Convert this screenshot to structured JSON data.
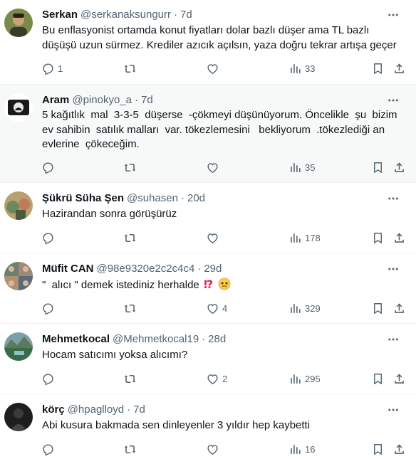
{
  "tweets": [
    {
      "name": "Serkan",
      "handle": "@serkanaksungurr",
      "time": "7d",
      "text": "Bu enflasyonist ortamda konut fiyatları dolar bazlı düşer ama TL bazlı düşüşü uzun sürmez. Krediler azıcık açılsın, yaza doğru tekrar artışa geçer",
      "replies": "1",
      "retweets": "",
      "likes": "",
      "views": "33",
      "avatar_color": "#6b7f3a"
    },
    {
      "name": "Aram",
      "handle": "@pinokyo_a",
      "time": "7d",
      "text": "5 kağıtlık  mal  3-3-5  düşerse  -çökmeyi düşünüyorum. Öncelikle  şu  bizim ev sahibin  satılık malları  var. tökezlemesini   bekliyorum  .tökezlediği an evlerine  çökeceğim.",
      "replies": "",
      "retweets": "",
      "likes": "",
      "views": "35",
      "avatar_color": "#1a1a1a"
    },
    {
      "name": "Şükrü Süha Şen",
      "handle": "@suhasen",
      "time": "20d",
      "text": "Hazirandan sonra görüşürüz",
      "replies": "",
      "retweets": "",
      "likes": "",
      "views": "178",
      "avatar_color": "#a08a4a"
    },
    {
      "name": "Müfit CAN",
      "handle": "@98e9320e2c2c4c4",
      "time": "29d",
      "text": "\"  alıcı \" demek istediniz herhalde ⁉️🥹",
      "text_plain": "\"  alıcı \" demek istediniz herhalde ",
      "replies": "",
      "retweets": "",
      "likes": "4",
      "views": "329",
      "avatar_color": "#8a6f5a"
    },
    {
      "name": "Mehmetkocal",
      "handle": "@Mehmetkocal19",
      "time": "28d",
      "text": "Hocam satıcımı yoksa alıcımı?",
      "replies": "",
      "retweets": "",
      "likes": "2",
      "views": "295",
      "avatar_color": "#4f7a5a"
    },
    {
      "name": "körç",
      "handle": "@hpaglloyd",
      "time": "7d",
      "text": "Abi kusura bakmada sen dinleyenler 3 yıldır hep kaybetti",
      "replies": "",
      "retweets": "",
      "likes": "",
      "views": "16",
      "avatar_color": "#2b2b2b"
    }
  ],
  "icons": {
    "reply": "reply-icon",
    "retweet": "retweet-icon",
    "like": "heart-icon",
    "views": "views-icon",
    "bookmark": "bookmark-icon",
    "share": "share-icon",
    "more": "more-icon"
  },
  "colors": {
    "text": "#0f1419",
    "secondary": "#536471",
    "highlight_bg": "#f7f9f9",
    "divider": "#eff3f4"
  }
}
